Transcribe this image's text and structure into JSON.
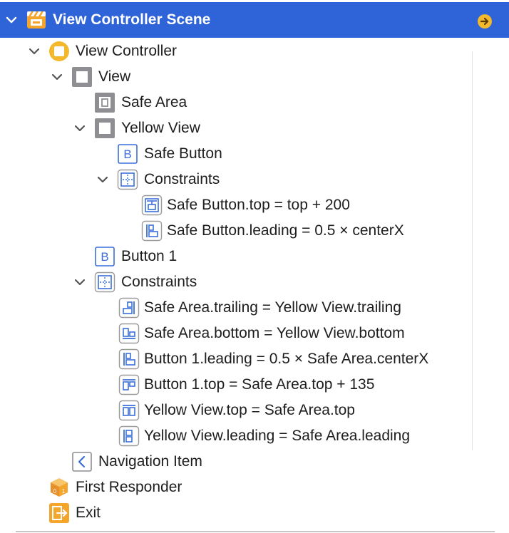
{
  "scene": {
    "title": "View Controller Scene",
    "colors": {
      "header_bg": "#2f63d8",
      "accent_orange": "#f4a52c",
      "constraint_blue": "#2f63d8"
    }
  },
  "tree": {
    "view_controller": "View Controller",
    "view": "View",
    "safe_area": "Safe Area",
    "yellow_view": "Yellow View",
    "safe_button": "Safe Button",
    "yellow_constraints": "Constraints",
    "yv_constraints": [
      "Safe Button.top = top + 200",
      "Safe Button.leading = 0.5 × centerX"
    ],
    "button_1": "Button 1",
    "view_constraints": "Constraints",
    "v_constraints": [
      "Safe Area.trailing = Yellow View.trailing",
      "Safe Area.bottom = Yellow View.bottom",
      "Button 1.leading = 0.5 × Safe Area.centerX",
      "Button 1.top = Safe Area.top + 135",
      "Yellow View.top = Safe Area.top",
      "Yellow View.leading = Safe Area.leading"
    ],
    "navigation_item": "Navigation Item",
    "first_responder": "First Responder",
    "exit": "Exit"
  }
}
